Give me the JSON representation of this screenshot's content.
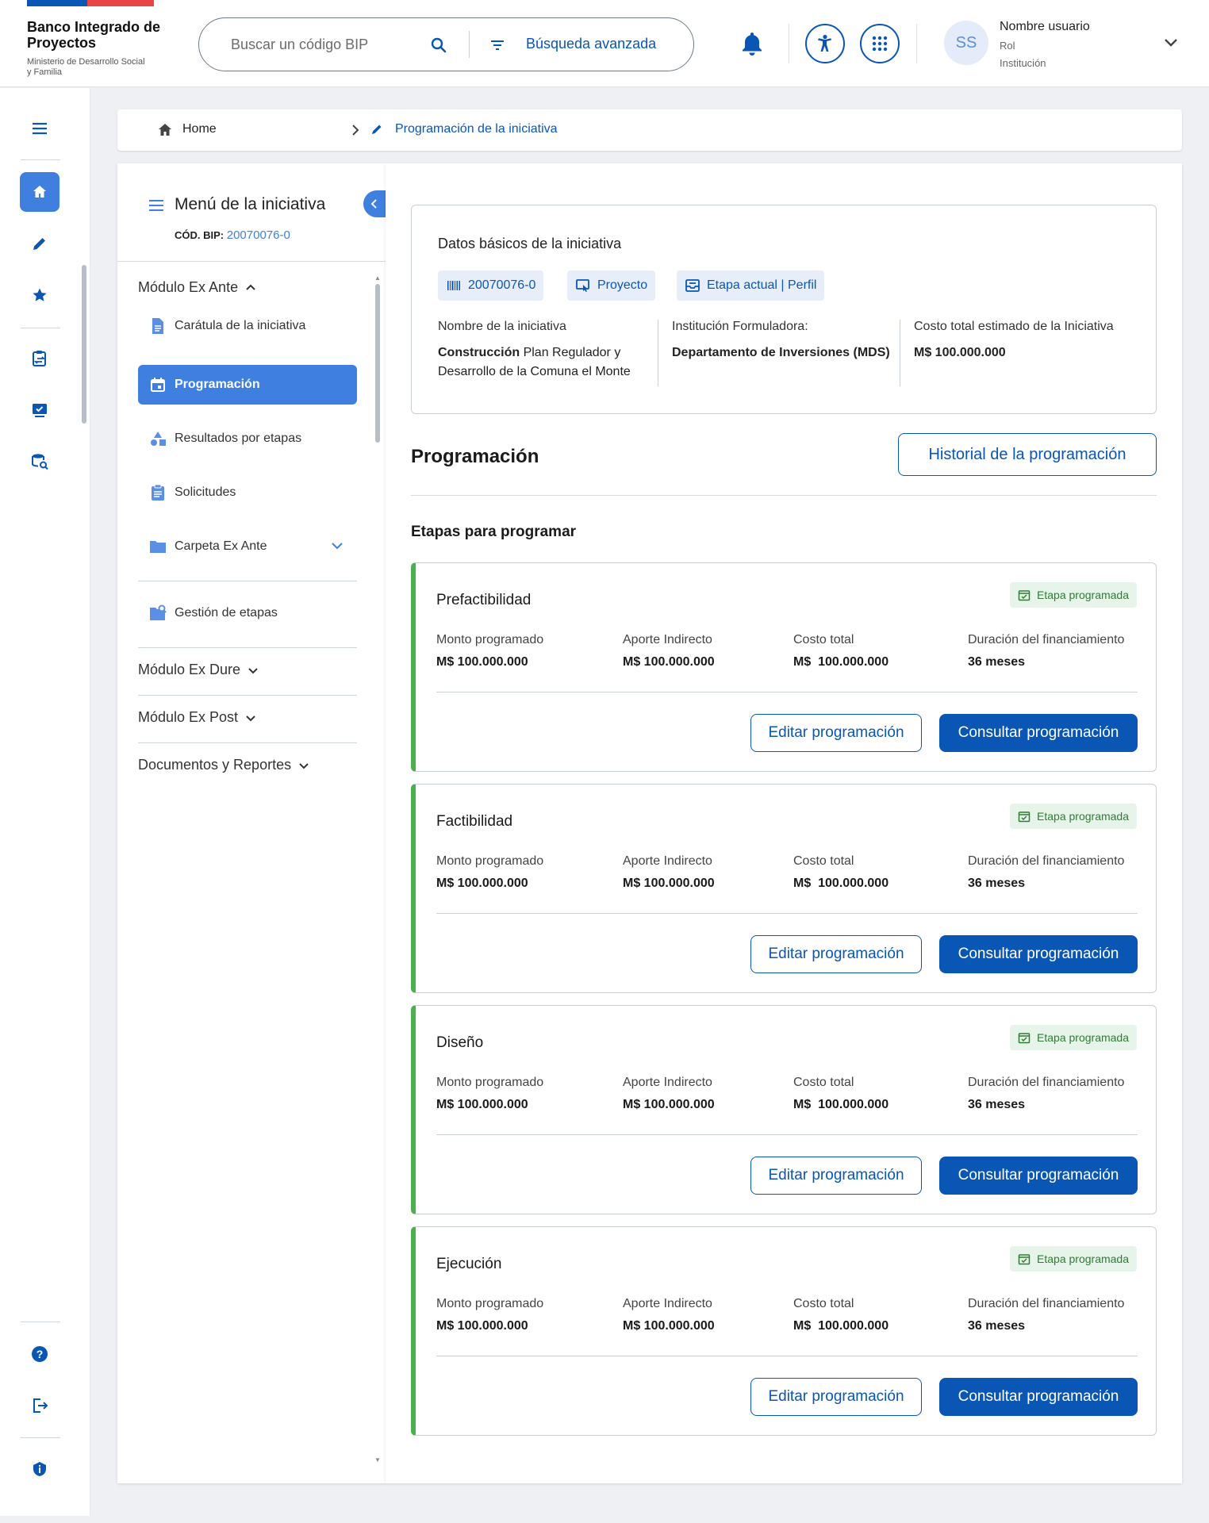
{
  "header": {
    "brand_title": "Banco Integrado de Proyectos",
    "brand_subtitle": "Ministerio de Desarrollo Social y Familia",
    "search_placeholder": "Buscar un código BIP",
    "advanced_search": "Búsqueda avanzada",
    "avatar_initials": "SS",
    "user_name": "Nombre usuario",
    "user_role": "Rol",
    "user_institution": "Institución",
    "icons": [
      "search-icon",
      "filter-icon",
      "bell-icon",
      "accessibility-icon",
      "apps-grid-icon",
      "chevron-down-icon"
    ]
  },
  "rail": {
    "icons": [
      "menu-icon",
      "home-icon",
      "pencil-icon",
      "star-icon",
      "clipboard-swap-icon",
      "monitor-check-icon",
      "database-search-icon",
      "help-icon",
      "logout-icon",
      "info-icon"
    ]
  },
  "breadcrumb": {
    "home": "Home",
    "current": "Programación de la iniciativa"
  },
  "menu": {
    "title": "Menú de la iniciativa",
    "code_label": "CÓD. BIP:",
    "code_value": "20070076-0",
    "modules": {
      "ex_ante": "Módulo Ex Ante",
      "ex_dure": "Módulo Ex Dure",
      "ex_post": "Módulo Ex Post",
      "docs": "Documentos y Reportes"
    },
    "items": [
      {
        "label": "Carátula de la iniciativa"
      },
      {
        "label": "Programación"
      },
      {
        "label": "Resultados por etapas"
      },
      {
        "label": "Solicitudes"
      },
      {
        "label": "Carpeta Ex Ante"
      },
      {
        "label": "Gestión de etapas"
      }
    ]
  },
  "basic": {
    "title": "Datos básicos de la iniciativa",
    "chips": [
      "20070076-0",
      "Proyecto",
      "Etapa actual | Perfil"
    ],
    "name_label": "Nombre de la iniciativa",
    "name_bold": "Construcción",
    "name_rest": " Plan Regulador y Desarrollo de la Comuna el Monte",
    "inst_label": "Institución Formuladora:",
    "inst_value": "Departamento de Inversiones (MDS)",
    "cost_label": "Costo total estimado de la Iniciativa",
    "cost_value": "M$ 100.000.000"
  },
  "programacion": {
    "title": "Programación",
    "history_button": "Historial de la programación",
    "stages_title": "Etapas para programar",
    "badge": "Etapa programada",
    "labels": {
      "monto": "Monto programado",
      "aporte": "Aporte Indirecto",
      "costo": "Costo total",
      "duracion": "Duración del financiamiento"
    },
    "edit_button": "Editar programación",
    "view_button": "Consultar programación",
    "stages": [
      {
        "name": "Prefactibilidad",
        "monto": "M$ 100.000.000",
        "aporte": "M$ 100.000.000",
        "costo": "M$  100.000.000",
        "duracion": "36 meses"
      },
      {
        "name": "Factibilidad",
        "monto": "M$ 100.000.000",
        "aporte": "M$ 100.000.000",
        "costo": "M$  100.000.000",
        "duracion": "36 meses"
      },
      {
        "name": "Diseño",
        "monto": "M$ 100.000.000",
        "aporte": "M$ 100.000.000",
        "costo": "M$  100.000.000",
        "duracion": "36 meses"
      },
      {
        "name": "Ejecución",
        "monto": "M$ 100.000.000",
        "aporte": "M$ 100.000.000",
        "costo": "M$  100.000.000",
        "duracion": "36 meses"
      }
    ]
  },
  "colors": {
    "primary": "#0a56b5",
    "accent": "#3e7fe0",
    "success": "#4caf50"
  }
}
